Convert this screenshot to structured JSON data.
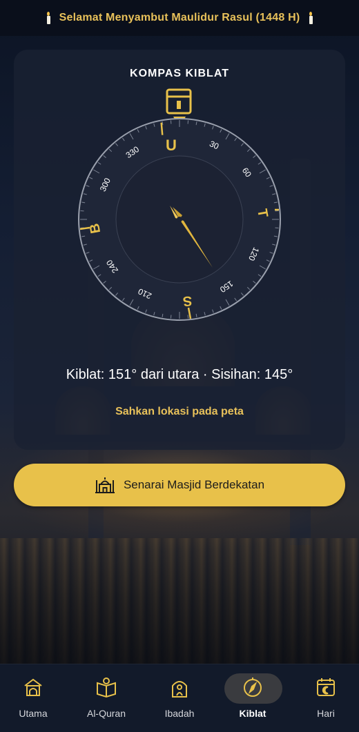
{
  "banner": {
    "text": "Selamat Menyambut Maulidur Rasul (1448 H)"
  },
  "compass": {
    "title": "KOMPAS KIBLAT",
    "cardinals": {
      "north": "U",
      "east": "T",
      "south": "S",
      "west": "B"
    },
    "degree_labels": [
      "30",
      "60",
      "120",
      "150",
      "210",
      "240",
      "300",
      "330"
    ],
    "qibla_bearing_deg": 151,
    "heading_deviation_deg": 145,
    "info_text": "Kiblat: 151° dari utara · Sisihan: 145°",
    "verify_link": "Sahkan lokasi pada peta"
  },
  "actions": {
    "nearby_mosques": "Senarai Masjid Berdekatan"
  },
  "nav": {
    "items": [
      {
        "label": "Utama",
        "icon": "home-mosque-icon"
      },
      {
        "label": "Al-Quran",
        "icon": "quran-icon"
      },
      {
        "label": "Ibadah",
        "icon": "prayer-icon"
      },
      {
        "label": "Kiblat",
        "icon": "compass-icon",
        "active": true
      },
      {
        "label": "Hari",
        "icon": "calendar-icon"
      }
    ]
  },
  "colors": {
    "accent": "#e8c14a",
    "card_bg": "#1a2132",
    "nav_bg": "#121a2a"
  }
}
